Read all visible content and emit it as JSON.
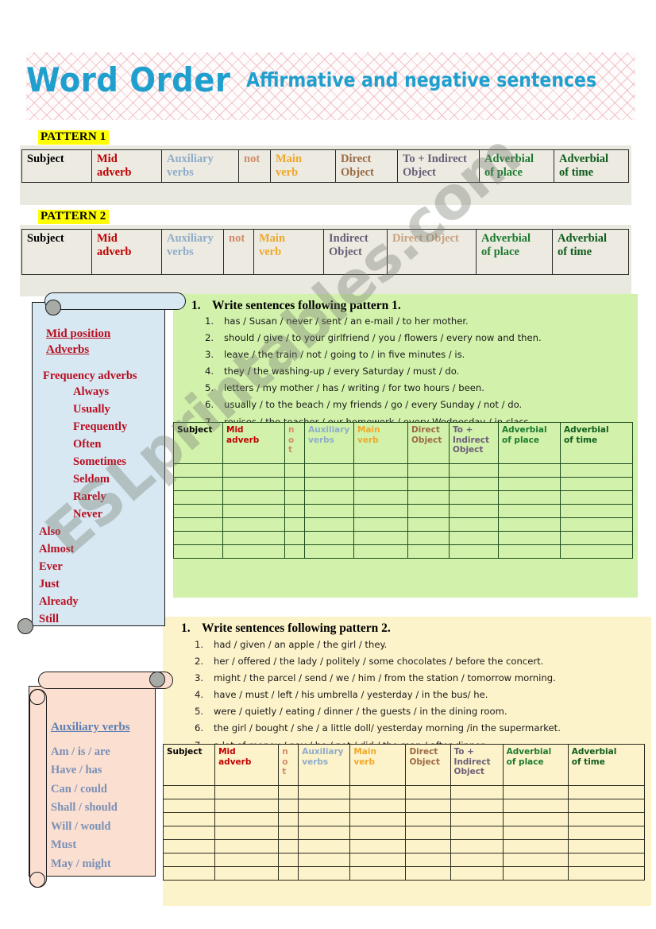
{
  "title": {
    "main": "Word Order",
    "subtitle": "Affirmative and negative sentences",
    "accent_color": "#1f9fce"
  },
  "pattern_sections": [
    {
      "label": "PATTERN 1",
      "headers": [
        "Subject",
        "Mid adverb",
        "Auxiliary verbs",
        "not",
        "Main verb",
        "Direct Object",
        "To + Indirect Object",
        "Adverbial of place",
        "Adverbial of time"
      ]
    },
    {
      "label": "PATTERN 2",
      "headers": [
        "Subject",
        "Mid adverb",
        "Auxiliary verbs",
        "not",
        "Main verb",
        "Indirect Object",
        "Direct Object",
        "Adverbial of place",
        "Adverbial of time"
      ]
    }
  ],
  "pattern1_cells": {
    "subject": "Subject",
    "mid_adverb_1": "Mid",
    "mid_adverb_2": "adverb",
    "aux_1": "Auxiliary",
    "aux_2": "verbs",
    "not": "not",
    "main_1": "Main",
    "main_2": "verb",
    "direct_1": "Direct",
    "direct_2": "Object",
    "indirect_1": "To + Indirect",
    "indirect_2": "Object",
    "place_1": "Adverbial",
    "place_2": "of place",
    "time_1": "Adverbial",
    "time_2": "of time"
  },
  "pattern2_cells": {
    "subject": "Subject",
    "mid_adverb_1": "Mid",
    "mid_adverb_2": "adverb",
    "aux_1": "Auxiliary",
    "aux_2": "verbs",
    "not": "not",
    "main_1": "Main",
    "main_2": "verb",
    "indirect_1": "Indirect",
    "indirect_2": "Object",
    "direct": "Direct Object",
    "place_1": "Adverbial",
    "place_2": "of place",
    "time_1": "Adverbial",
    "time_2": "of time"
  },
  "adverbs_box": {
    "title_line1": "Mid position",
    "title_line2": " Adverbs",
    "group_title": "Frequency adverbs",
    "frequency": [
      "Always",
      "Usually",
      "Frequently",
      "Often",
      "Sometimes",
      "Seldom",
      "Rarely",
      "Never"
    ],
    "others": [
      "Also",
      "Almost",
      "Ever",
      "Just",
      "Already",
      "Still"
    ],
    "text_color": "#b80d20",
    "fill_color": "#d7e8f2"
  },
  "auxiliary_box": {
    "title": "Auxiliary verbs",
    "items": [
      "Am  / is / are",
      "Have / has",
      "Can  / could",
      "Shall  / should",
      "Will  / would",
      "Must",
      "May  / might"
    ],
    "text_color": "#7a90b8",
    "fill_color": "#fbdfd0"
  },
  "exercise1": {
    "number": "1.",
    "heading": "Write sentences following pattern 1.",
    "fill_color": "#d2f2ab",
    "sentences": [
      "has / Susan / never / sent / an e-mail / to her mother.",
      "should / give / to your girlfriend / you / flowers / every now and then.",
      "leave / the train / not / going to / in five minutes / is.",
      "they / the washing-up / every Saturday / must / do.",
      "letters / my mother / has / writing / for two hours / been.",
      "usually / to the beach / my friends / go / every Sunday / not / do.",
      "revises / the teacher / our homework / every Wednesday / in class."
    ],
    "table_headers": {
      "subject": "Subject",
      "mid_1": "Mid",
      "mid_2": "adverb",
      "not_letters": [
        "n",
        "o",
        "t"
      ],
      "aux_1": "Auxiliary",
      "aux_2": "verbs",
      "main_1": "Main",
      "main_2": "verb",
      "direct_1": "Direct",
      "direct_2": "Object",
      "indirect_1": "To +",
      "indirect_2": "Indirect",
      "indirect_3": "Object",
      "place_1": "Adverbial",
      "place_2": "of place",
      "time_1": "Adverbial",
      "time_2": "of time"
    },
    "empty_rows": 7
  },
  "exercise2": {
    "number": "1.",
    "heading": "Write sentences following pattern 2.",
    "fill_color": "#fdf3ca",
    "sentences": [
      "had / given / an apple / the girl / they.",
      "her / offered / the lady / politely / some chocolates / before the concert.",
      "might / the parcel / send / we / him / from the station / tomorrow morning.",
      "have / must / left / his umbrella / yesterday / in the bus/ he.",
      "were / quietly / eating / dinner / the guests / in the dining room.",
      "the girl / bought / she / a little doll/ yesterday morning /in the supermarket.",
      "a lot of money / pay / he / not / did / the man / after dinner."
    ],
    "table_headers": {
      "subject": "Subject",
      "mid_1": "Mid",
      "mid_2": "adverb",
      "not_letters": [
        "n",
        "o",
        "t"
      ],
      "aux_1": "Auxiliary",
      "aux_2": "verbs",
      "main_1": "Main",
      "main_2": "verb",
      "direct_1": "Direct",
      "direct_2": "Object",
      "indirect_1": "To +",
      "indirect_2": "Indirect",
      "indirect_3": "Object",
      "place_1": "Adverbial",
      "place_2": "of place",
      "time_1": "Adverbial",
      "time_2": "of time"
    },
    "empty_rows": 7
  },
  "watermark": {
    "text": "ESLprintables.com"
  }
}
